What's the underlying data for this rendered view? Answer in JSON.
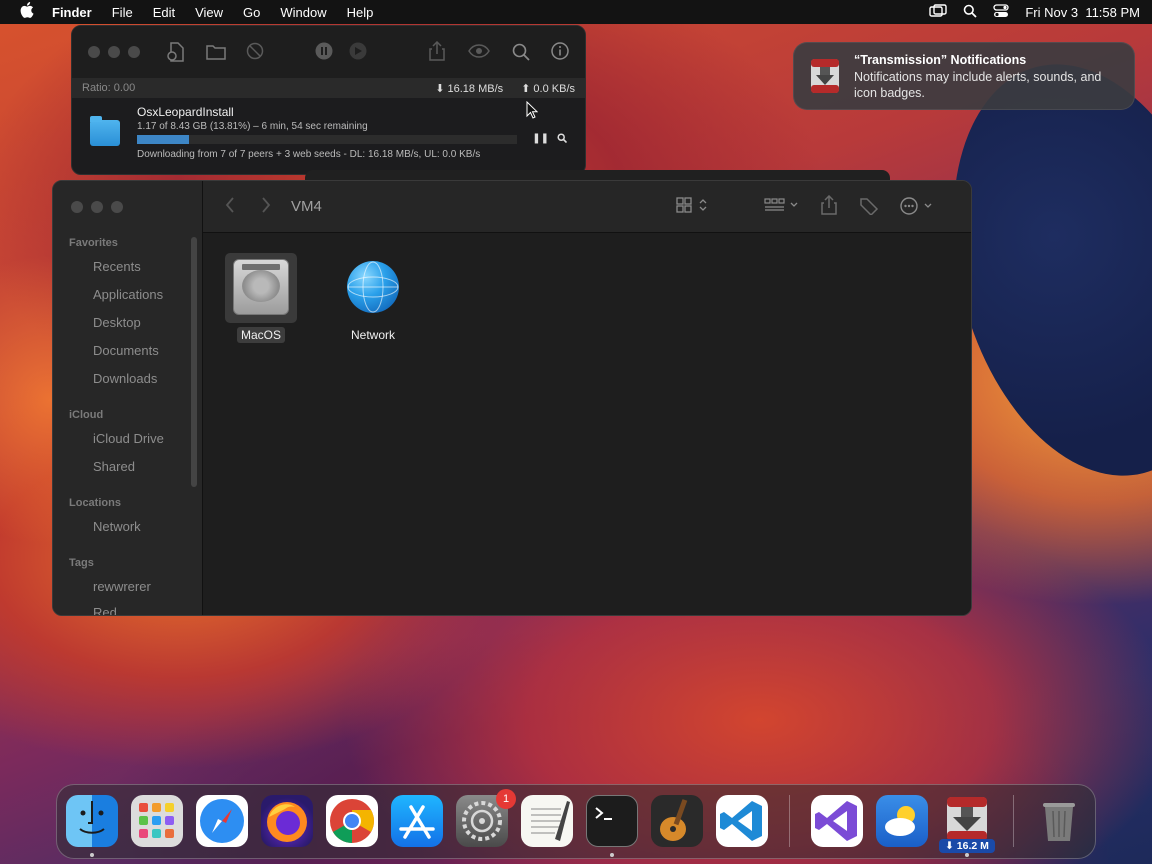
{
  "menubar": {
    "app_name": "Finder",
    "menus": [
      "File",
      "Edit",
      "View",
      "Go",
      "Window",
      "Help"
    ],
    "clock": "Fri Nov 3  11:58 PM"
  },
  "transmission": {
    "ratio": "Ratio: 0.00",
    "download_speed": "16.18 MB/s",
    "upload_speed": "0.0 KB/s",
    "torrent": {
      "name": "OsxLeopardInstall",
      "progress_text": "1.17 of 8.43 GB (13.81%) – 6 min, 54 sec remaining",
      "progress": 0.1381,
      "peers_text": "Downloading from 7 of 7 peers + 3 web seeds - DL: 16.18 MB/s, UL: 0.0 KB/s"
    }
  },
  "notification": {
    "title": "“Transmission” Notifications",
    "body": "Notifications may include alerts, sounds, and icon badges."
  },
  "finder": {
    "path_title": "VM4",
    "sidebar": {
      "favorites_header": "Favorites",
      "favorites": [
        "Recents",
        "Applications",
        "Desktop",
        "Documents",
        "Downloads"
      ],
      "icloud_header": "iCloud",
      "icloud": [
        "iCloud Drive",
        "Shared"
      ],
      "locations_header": "Locations",
      "locations": [
        "Network"
      ],
      "tags_header": "Tags",
      "tags": [
        "rewwrerer",
        "Red"
      ]
    },
    "items": [
      {
        "label": "MacOS",
        "selected": true
      },
      {
        "label": "Network",
        "selected": false
      }
    ]
  },
  "dock": {
    "apps": [
      "Finder",
      "Launchpad",
      "Safari",
      "Firefox",
      "Chrome",
      "App Store",
      "System Settings",
      "TextEdit",
      "Terminal",
      "GarageBand",
      "VS Code",
      "Visual Studio",
      "Weather",
      "Transmission",
      "Trash"
    ],
    "settings_badge": "1",
    "transmission_badge": "⬇ 16.2 M"
  },
  "colors": {
    "accent_blue": "#3d86c6",
    "badge_red": "#e53935"
  }
}
